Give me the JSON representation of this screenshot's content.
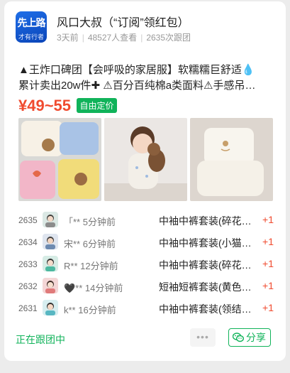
{
  "header": {
    "logo_line1": "先上路",
    "logo_line2": "才有行者",
    "title": "风口大叔（“订阅”领红包）",
    "meta": [
      "3天前",
      "48527人查看",
      "2635次跟团"
    ]
  },
  "product": {
    "desc_line1": "▲王炸口碑团【会呼吸的家居服】软糯糯巨舒适💧",
    "desc_line2": "累计卖出20w件✚ ⚠百分百纯棉a类面料⚠手感吊…",
    "price": "¥49~55",
    "price_tag": "自由定价"
  },
  "photos": [
    {
      "icon": "kids-clothing-photo"
    },
    {
      "icon": "child-with-teddy-bear-photo"
    },
    {
      "icon": "white-pajamas-photo"
    }
  ],
  "orders": [
    {
      "num": "2635",
      "user": "「** 5分钟前",
      "item": "中袖中裤套装(碎花…",
      "qty": "+1"
    },
    {
      "num": "2634",
      "user": "宋** 6分钟前",
      "item": "中袖中裤套装(小猫…",
      "qty": "+1"
    },
    {
      "num": "2633",
      "user": "R** 12分钟前",
      "item": "中袖中裤套装(碎花…",
      "qty": "+1"
    },
    {
      "num": "2632",
      "user": "🖤** 14分钟前",
      "item": "短袖短裤套装(黄色…",
      "qty": "+1"
    },
    {
      "num": "2631",
      "user": "k** 16分钟前",
      "item": "中袖中裤套装(领结…",
      "qty": "+1"
    }
  ],
  "footer": {
    "status": "正在跟团中",
    "more": "•••",
    "share": "分享"
  },
  "colors": {
    "accent": "#10b35a",
    "price": "#f04b2f",
    "brand": "#1f6fe8"
  }
}
